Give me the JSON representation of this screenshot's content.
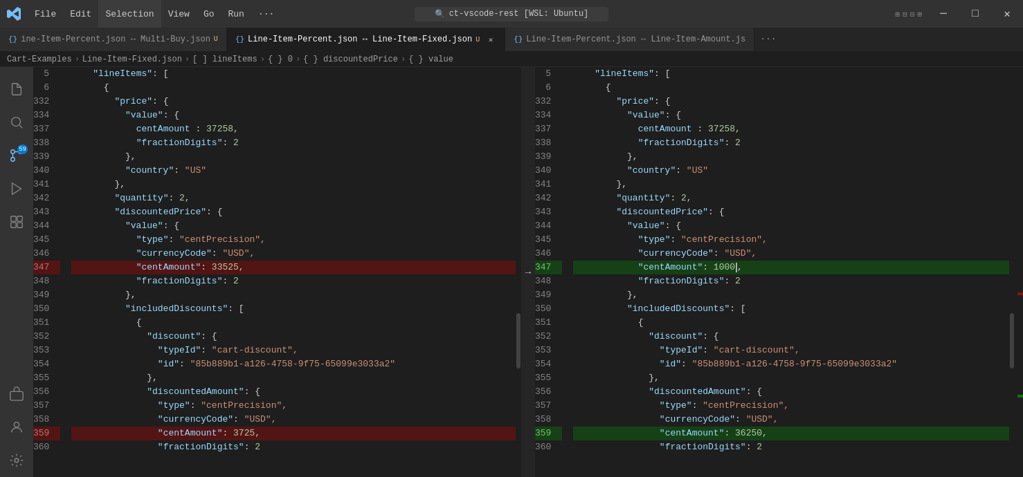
{
  "titlebar": {
    "logo": "◈",
    "menu": [
      "File",
      "Edit",
      "Selection",
      "View",
      "Go",
      "Run",
      "···"
    ],
    "title": "ct-vscode-rest [WSL: Ubuntu]",
    "search_icon": "🔍",
    "win_buttons": [
      "─",
      "□",
      "✕"
    ]
  },
  "tabs": [
    {
      "id": "tab1",
      "icon": "{}",
      "label": "ine-Item-Percent.json ↔ Multi-Buy.json",
      "section": "Cart-Examples",
      "dirty": "U",
      "active": false,
      "closeable": false
    },
    {
      "id": "tab2",
      "icon": "{}",
      "label": "Line-Item-Percent.json ↔ Line-Item-Fixed.json",
      "section": "Cart-Examples",
      "dirty": "U",
      "active": true,
      "closeable": true
    },
    {
      "id": "tab3",
      "icon": "{}",
      "label": "Line-Item-Percent.json ↔ Line-Item-Amount.js",
      "section": "",
      "dirty": "",
      "active": false,
      "closeable": false
    }
  ],
  "breadcrumb": [
    "Cart-Examples",
    "Line-Item-Fixed.json",
    "[ ] lineItems",
    "{ } 0",
    "{ } discountedPrice",
    "{ } value"
  ],
  "activity_icons": [
    "files",
    "search",
    "source-control",
    "debug",
    "extensions",
    "remote",
    "account",
    "settings"
  ],
  "left_pane": {
    "lines": [
      {
        "num": "5",
        "type": "normal",
        "text": "    \"lineItems\": ["
      },
      {
        "num": "6",
        "type": "normal",
        "text": "      {"
      },
      {
        "num": "332",
        "type": "normal",
        "text": "        \"price\": {"
      },
      {
        "num": "334",
        "type": "normal",
        "text": "          \"value\": {"
      },
      {
        "num": "337",
        "type": "normal",
        "text": "            centAmount : 37258,"
      },
      {
        "num": "338",
        "type": "normal",
        "text": "            \"fractionDigits\": 2"
      },
      {
        "num": "339",
        "type": "normal",
        "text": "          },"
      },
      {
        "num": "340",
        "type": "normal",
        "text": "          \"country\": \"US\""
      },
      {
        "num": "341",
        "type": "normal",
        "text": "        },"
      },
      {
        "num": "342",
        "type": "normal",
        "text": "        \"quantity\": 2,"
      },
      {
        "num": "343",
        "type": "normal",
        "text": "        \"discountedPrice\": {"
      },
      {
        "num": "344",
        "type": "normal",
        "text": "          \"value\": {"
      },
      {
        "num": "345",
        "type": "normal",
        "text": "            \"type\": \"centPrecision\","
      },
      {
        "num": "346",
        "type": "normal",
        "text": "            \"currencyCode\": \"USD\","
      },
      {
        "num": "347",
        "type": "deleted",
        "text": "            \"centAmount\": 33525,"
      },
      {
        "num": "348",
        "type": "normal",
        "text": "            \"fractionDigits\": 2"
      },
      {
        "num": "349",
        "type": "normal",
        "text": "          },"
      },
      {
        "num": "350",
        "type": "normal",
        "text": "          \"includedDiscounts\": ["
      },
      {
        "num": "351",
        "type": "normal",
        "text": "            {"
      },
      {
        "num": "352",
        "type": "normal",
        "text": "              \"discount\": {"
      },
      {
        "num": "353",
        "type": "normal",
        "text": "                \"typeId\": \"cart-discount\","
      },
      {
        "num": "354",
        "type": "normal",
        "text": "                \"id\": \"85b889b1-a126-4758-9f75-65099e3033a2\""
      },
      {
        "num": "355",
        "type": "normal",
        "text": "              },"
      },
      {
        "num": "356",
        "type": "normal",
        "text": "              \"discountedAmount\": {"
      },
      {
        "num": "357",
        "type": "normal",
        "text": "                \"type\": \"centPrecision\","
      },
      {
        "num": "358",
        "type": "normal",
        "text": "                \"currencyCode\": \"USD\","
      },
      {
        "num": "359",
        "type": "deleted",
        "text": "                \"centAmount\": 3725,"
      },
      {
        "num": "360",
        "type": "normal",
        "text": "                \"fractionDigits\": 2"
      }
    ]
  },
  "right_pane": {
    "lines": [
      {
        "num": "5",
        "type": "normal",
        "text": "    \"lineItems\": ["
      },
      {
        "num": "6",
        "type": "normal",
        "text": "      {"
      },
      {
        "num": "332",
        "type": "normal",
        "text": "        \"price\": {"
      },
      {
        "num": "334",
        "type": "normal",
        "text": "          \"value\": {"
      },
      {
        "num": "337",
        "type": "normal",
        "text": "            centAmount : 37258,"
      },
      {
        "num": "338",
        "type": "normal",
        "text": "            \"fractionDigits\": 2"
      },
      {
        "num": "339",
        "type": "normal",
        "text": "          },"
      },
      {
        "num": "340",
        "type": "normal",
        "text": "          \"country\": \"US\""
      },
      {
        "num": "341",
        "type": "normal",
        "text": "        },"
      },
      {
        "num": "342",
        "type": "normal",
        "text": "        \"quantity\": 2,"
      },
      {
        "num": "343",
        "type": "normal",
        "text": "        \"discountedPrice\": {"
      },
      {
        "num": "344",
        "type": "normal",
        "text": "          \"value\": {"
      },
      {
        "num": "345",
        "type": "normal",
        "text": "            \"type\": \"centPrecision\","
      },
      {
        "num": "346",
        "type": "normal",
        "text": "            \"currencyCode\": \"USD\","
      },
      {
        "num": "347",
        "type": "added",
        "text": "            \"centAmount\": 1000,"
      },
      {
        "num": "348",
        "type": "normal",
        "text": "            \"fractionDigits\": 2"
      },
      {
        "num": "349",
        "type": "normal",
        "text": "          },"
      },
      {
        "num": "350",
        "type": "normal",
        "text": "          \"includedDiscounts\": ["
      },
      {
        "num": "351",
        "type": "normal",
        "text": "            {"
      },
      {
        "num": "352",
        "type": "normal",
        "text": "              \"discount\": {"
      },
      {
        "num": "353",
        "type": "normal",
        "text": "                \"typeId\": \"cart-discount\","
      },
      {
        "num": "354",
        "type": "normal",
        "text": "                \"id\": \"85b889b1-a126-4758-9f75-65099e3033a2\""
      },
      {
        "num": "355",
        "type": "normal",
        "text": "              },"
      },
      {
        "num": "356",
        "type": "normal",
        "text": "              \"discountedAmount\": {"
      },
      {
        "num": "357",
        "type": "normal",
        "text": "                \"type\": \"centPrecision\","
      },
      {
        "num": "358",
        "type": "normal",
        "text": "                \"currencyCode\": \"USD\","
      },
      {
        "num": "359",
        "type": "added",
        "text": "                \"centAmount\": 36250,"
      },
      {
        "num": "360",
        "type": "normal",
        "text": "                \"fractionDigits\": 2"
      }
    ]
  },
  "colors": {
    "deleted_bg": "rgba(180,0,0,0.35)",
    "added_bg": "rgba(0,150,0,0.28)",
    "accent": "#007acc"
  }
}
